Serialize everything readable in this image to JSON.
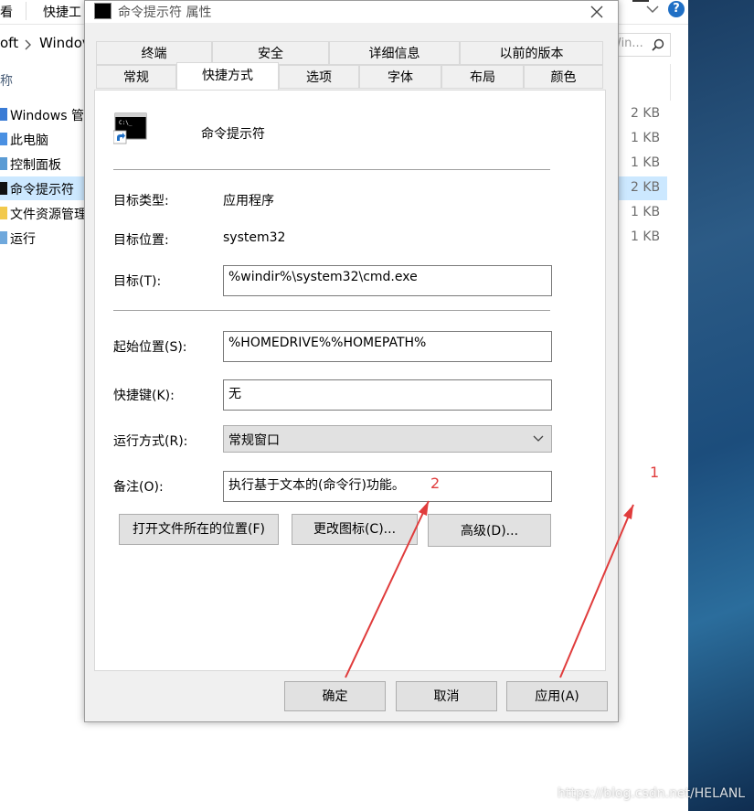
{
  "explorer": {
    "toolbar": {
      "view_tab": "看",
      "quick_tab": "快捷工"
    },
    "address": {
      "crumb1": "oft",
      "crumb2": "Windov"
    },
    "search_placeholder": "Win...",
    "column_name": "称",
    "rows": [
      {
        "name": "Windows 管",
        "size": "2 KB"
      },
      {
        "name": "此电脑",
        "size": "1 KB"
      },
      {
        "name": "控制面板",
        "size": "1 KB"
      },
      {
        "name": "命令提示符",
        "size": "2 KB"
      },
      {
        "name": "文件资源管理",
        "size": "1 KB"
      },
      {
        "name": "运行",
        "size": "1 KB"
      }
    ]
  },
  "dialog": {
    "title": "命令提示符 属性",
    "tabs_row1": [
      "终端",
      "安全",
      "详细信息",
      "以前的版本"
    ],
    "tabs_row2": [
      "常规",
      "快捷方式",
      "选项",
      "字体",
      "布局",
      "颜色"
    ],
    "active_tab": "快捷方式",
    "shortcut_name": "命令提示符",
    "target_type_label": "目标类型:",
    "target_type_value": "应用程序",
    "target_location_label": "目标位置:",
    "target_location_value": "system32",
    "target_label": "目标(T):",
    "target_value": "%windir%\\system32\\cmd.exe",
    "start_in_label": "起始位置(S):",
    "start_in_value": "%HOMEDRIVE%%HOMEPATH%",
    "hotkey_label": "快捷键(K):",
    "hotkey_value": "无",
    "run_label": "运行方式(R):",
    "run_value": "常规窗口",
    "comment_label": "备注(O):",
    "comment_value": "执行基于文本的(命令行)功能。",
    "open_location_button": "打开文件所在的位置(F)",
    "change_icon_button": "更改图标(C)...",
    "advanced_button": "高级(D)...",
    "ok_button": "确定",
    "cancel_button": "取消",
    "apply_button": "应用(A)"
  },
  "annotations": {
    "label1": "1",
    "label2": "2",
    "color": "#e03c3c"
  },
  "watermark": "https://blog.csdn.net/HELANL"
}
